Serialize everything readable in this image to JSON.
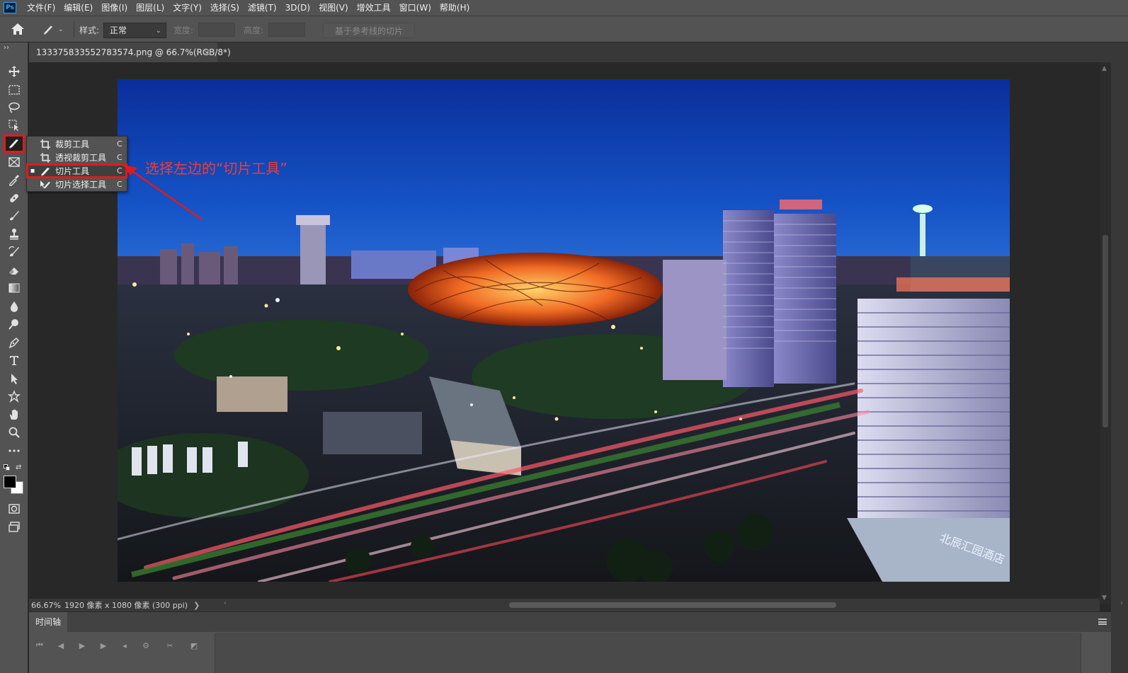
{
  "app": {
    "logo": "Ps"
  },
  "menubar": {
    "items": [
      "文件(F)",
      "编辑(E)",
      "图像(I)",
      "图层(L)",
      "文字(Y)",
      "选择(S)",
      "滤镜(T)",
      "3D(D)",
      "视图(V)",
      "增效工具",
      "窗口(W)",
      "帮助(H)"
    ]
  },
  "options": {
    "style_label": "样式:",
    "style_value": "正常",
    "width_label": "宽度:",
    "height_label": "高度:",
    "guides_button": "基于参考线的切片"
  },
  "toolbar": {
    "grip": "››",
    "tools": [
      "move-icon",
      "marquee-icon",
      "lasso-icon",
      "object-select-icon",
      "slice-icon",
      "frame-icon",
      "eyedropper-icon",
      "healing-icon",
      "brush-icon",
      "stamp-icon",
      "history-brush-icon",
      "eraser-icon",
      "gradient-icon",
      "blur-icon",
      "dodge-icon",
      "pen-icon",
      "type-icon",
      "path-select-icon",
      "shape-icon",
      "hand-icon",
      "zoom-icon",
      "more-icon"
    ],
    "active_tool": "slice-icon"
  },
  "document": {
    "tab_title": "133375833552783574.png @ 66.7%(RGB/8*)",
    "close_glyph": "×"
  },
  "flyout": {
    "items": [
      {
        "label": "裁剪工具",
        "key": "C",
        "selected": false,
        "icon": "crop-icon"
      },
      {
        "label": "透视裁剪工具",
        "key": "C",
        "selected": false,
        "icon": "perspective-crop-icon"
      },
      {
        "label": "切片工具",
        "key": "C",
        "selected": true,
        "icon": "slice-icon"
      },
      {
        "label": "切片选择工具",
        "key": "C",
        "selected": false,
        "icon": "slice-select-icon"
      }
    ],
    "bullet": "▪"
  },
  "annotation": {
    "text": "选择左边的“切片工具”",
    "color": "#f23a3a"
  },
  "status": {
    "zoom": "66.67%",
    "info": "1920 像素 x 1080 像素 (300 ppi)",
    "chevron": "❯"
  },
  "timeline": {
    "tab_label": "时间轴"
  },
  "colors": {
    "accent_red": "#e21a1a",
    "panel": "#535353",
    "workspace": "#282828"
  }
}
